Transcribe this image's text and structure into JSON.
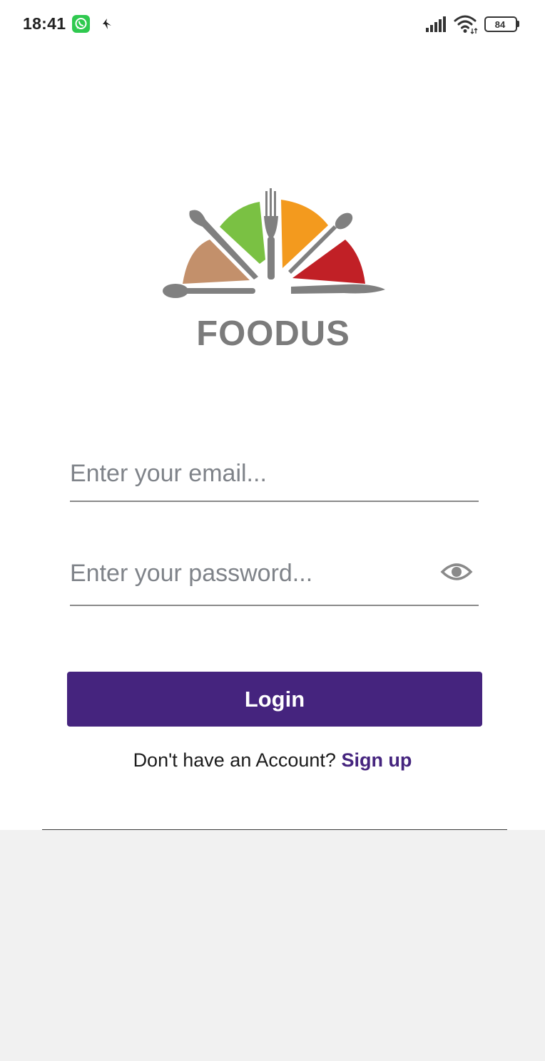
{
  "status_bar": {
    "time": "18:41",
    "battery_level": "84",
    "notification_icons": [
      "whatsapp-icon",
      "bird-icon"
    ],
    "system_icons": [
      "signal-icon",
      "wifi-icon",
      "battery-icon"
    ]
  },
  "logo": {
    "text": "FOODUS",
    "colors": {
      "brown": "#c3906b",
      "green": "#7ac143",
      "orange": "#f39a1e",
      "red": "#c12026",
      "gray": "#808080"
    }
  },
  "login_form": {
    "email_placeholder": "Enter your email...",
    "email_value": "",
    "password_placeholder": "Enter your password...",
    "password_value": "",
    "password_toggle_icon": "eye-icon",
    "login_label": "Login",
    "signup_prompt": "Don't have an Account?",
    "signup_label": "Sign up"
  },
  "theme": {
    "accent": "#45247e",
    "background": "#ffffff",
    "bottom_background": "#f1f1f1"
  }
}
